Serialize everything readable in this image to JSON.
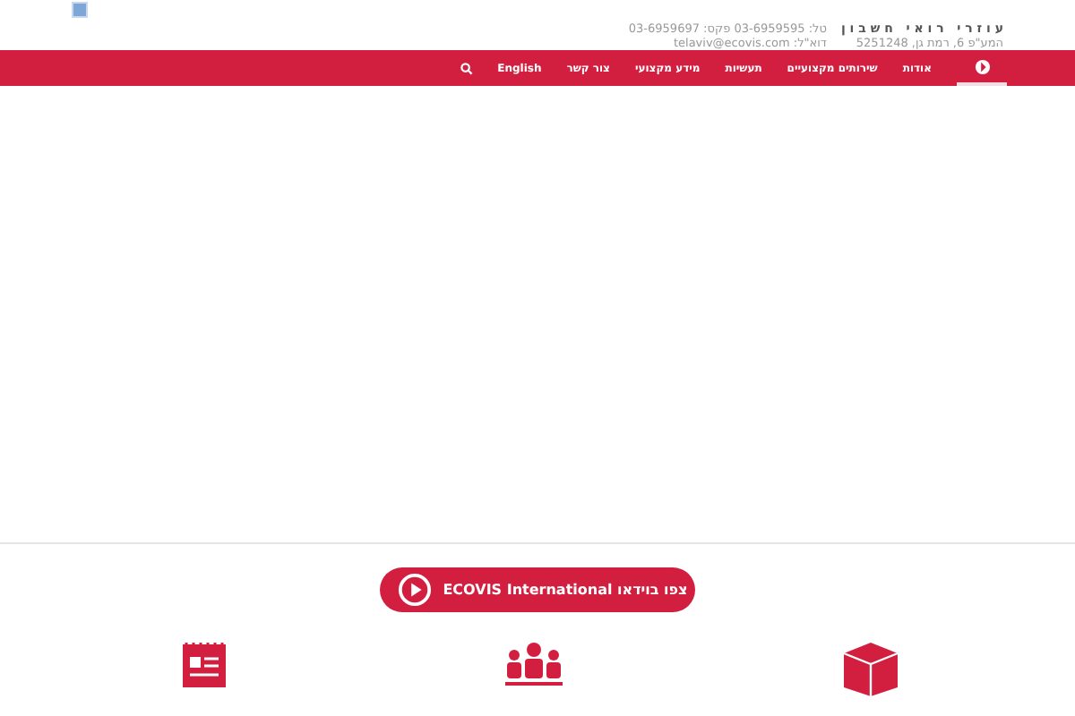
{
  "header": {
    "company": "ע ו ז ר י   ר ו א י   ח ש ב ו ן",
    "phone": "טל: 03-6959595 פקס: 03-6959697",
    "address": "המע\"פ 6, רמת גן, 5251248",
    "email": "דוא\"ל: telaviv@ecovis.com"
  },
  "nav": {
    "items": [
      {
        "label": "אודות",
        "selected": false
      },
      {
        "label": "שירותים מקצועיים",
        "selected": false
      },
      {
        "label": "תעשיות",
        "selected": false
      },
      {
        "label": "מידע מקצועי",
        "selected": false
      },
      {
        "label": "צור קשר",
        "selected": false
      },
      {
        "label": "English",
        "selected": false
      }
    ],
    "home_selected": true
  },
  "video_button": {
    "label": "צפו בוידאו ECOVIS International"
  }
}
